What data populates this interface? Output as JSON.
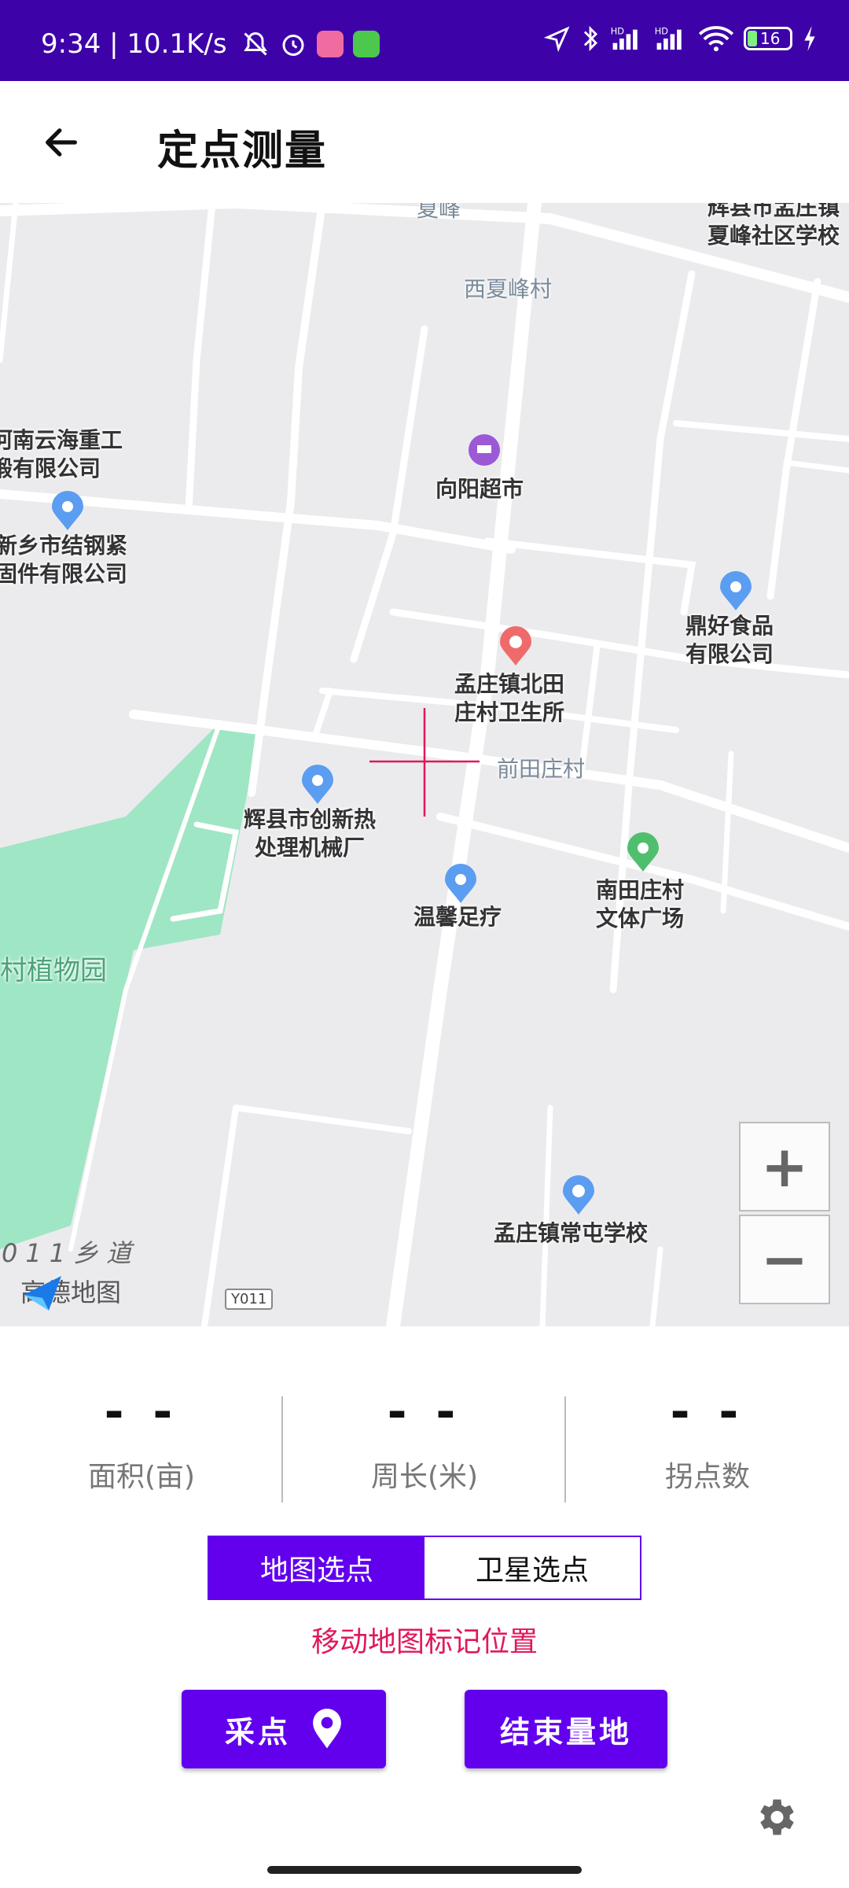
{
  "status_bar": {
    "time_speed": "9:34 | 10.1K/s",
    "battery": "16",
    "signal1": "HD",
    "signal2": "HD"
  },
  "app_bar": {
    "title": "定点测量"
  },
  "map": {
    "labels": {
      "xiafeng": "夏峰",
      "school_top": "辉县市孟庄镇\n夏峰社区学校",
      "xixiafeng": "西夏峰村",
      "yunhai": "河南云海重工\n锻有限公司",
      "xiangyang": "向阳超市",
      "jiegang": "新乡市结钢紧\n固件有限公司",
      "dinghao": "鼎好食品\n有限公司",
      "clinic": "孟庄镇北田\n庄村卫生所",
      "qiantian": "前田庄村",
      "chuangxin": "辉县市创新热\n处理机械厂",
      "wenxin": "温馨足疗",
      "plaza": "南田庄村\n文体广场",
      "botanic": "村植物园",
      "changtun": "孟庄镇常屯学校",
      "road": "011乡道",
      "road_sign": "Y011",
      "logo": "高德地图"
    },
    "zoom_in": "+",
    "zoom_out": "−",
    "colors": {
      "park": "#9fe6c4",
      "road": "#ffffff",
      "crosshair": "#e0195a"
    }
  },
  "stats": [
    {
      "value": "- -",
      "label": "面积(亩)"
    },
    {
      "value": "- -",
      "label": "周长(米)"
    },
    {
      "value": "- -",
      "label": "拐点数"
    }
  ],
  "segment": {
    "map_select": "地图选点",
    "satellite_select": "卫星选点"
  },
  "hint": "移动地图标记位置",
  "buttons": {
    "collect": "采点",
    "finish": "结束量地"
  },
  "accent": "#6200ee"
}
